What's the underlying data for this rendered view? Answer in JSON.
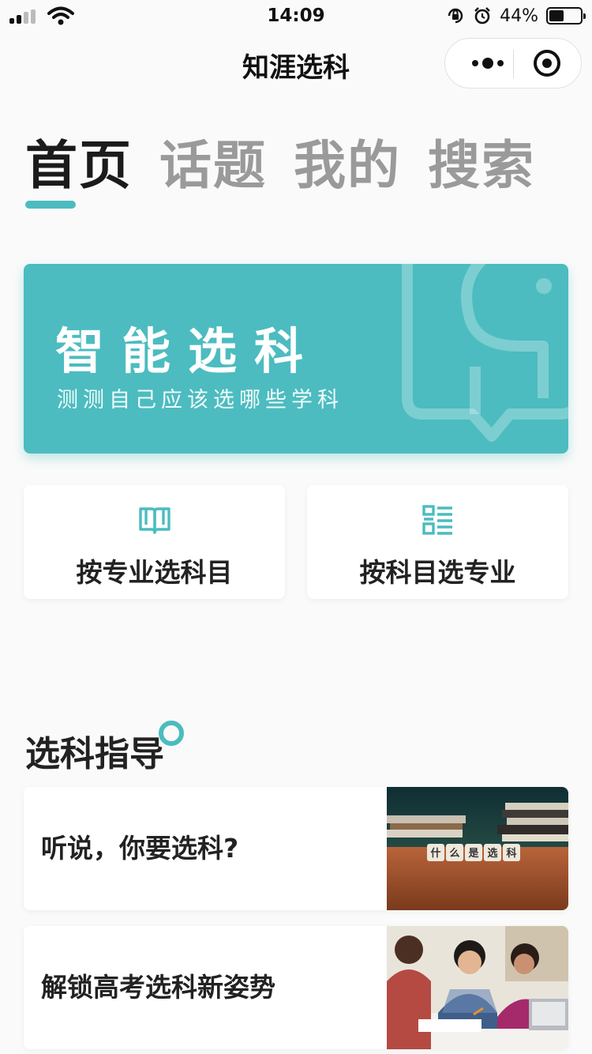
{
  "status_bar": {
    "time": "14:09",
    "battery": "44%"
  },
  "nav": {
    "title": "知涯选科"
  },
  "tabs": [
    {
      "label": "首页",
      "active": true
    },
    {
      "label": "话题",
      "active": false
    },
    {
      "label": "我的",
      "active": false
    },
    {
      "label": "搜索",
      "active": false
    }
  ],
  "banner": {
    "title": "智能选科",
    "subtitle": "测测自己应该选哪些学科"
  },
  "quick_actions": [
    {
      "label": "按专业选科目",
      "icon": "open-book-icon"
    },
    {
      "label": "按科目选专业",
      "icon": "list-icon"
    }
  ],
  "section": {
    "title": "选科指导"
  },
  "articles": [
    {
      "title": "听说，你要选科?",
      "thumb_caption": [
        "什",
        "么",
        "是",
        "选",
        "科"
      ]
    },
    {
      "title": "解锁高考选科新姿势"
    }
  ],
  "colors": {
    "accent": "#4bbcbf",
    "banner_bg": "#4cbcc0",
    "page_bg": "#fafafa"
  }
}
